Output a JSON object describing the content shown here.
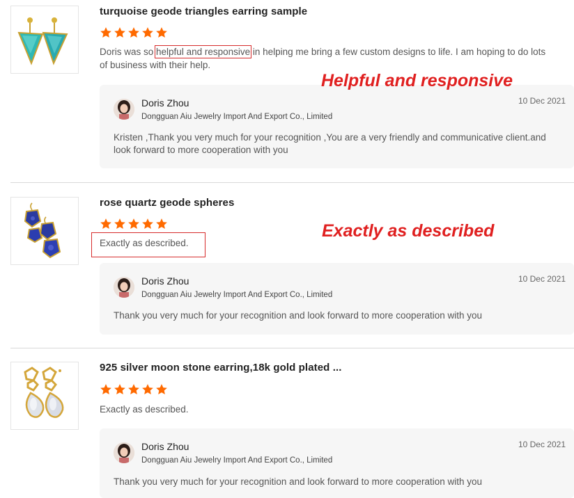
{
  "colors": {
    "star": "#ff6a00",
    "callout": "#e02020",
    "reply_bg": "#f6f6f6"
  },
  "reviews": [
    {
      "product_title": "turquoise geode triangles earring sample",
      "rating": 5,
      "comment_before": "Doris was so ",
      "comment_highlight": "helpful and responsive",
      "comment_after": " in helping me bring a few custom designs to life. I am hoping to do lots of business with their help.",
      "reply": {
        "name": "Doris Zhou",
        "company": "Dongguan Aiu Jewelry Import And Export Co., Limited",
        "date": "10 Dec 2021",
        "text": "Kristen ,Thank you very much for your recognition ,You are a very friendly and communicative client.and look forward to more cooperation with you"
      }
    },
    {
      "product_title": "rose quartz geode spheres",
      "rating": 5,
      "comment": "Exactly as described.",
      "reply": {
        "name": "Doris Zhou",
        "company": "Dongguan Aiu Jewelry Import And Export Co., Limited",
        "date": "10 Dec 2021",
        "text": "Thank you very much for your recognition and look forward to more cooperation with you"
      }
    },
    {
      "product_title": "925 silver moon stone earring,18k gold plated ...",
      "rating": 5,
      "comment": "Exactly as described.",
      "reply": {
        "name": "Doris Zhou",
        "company": "Dongguan Aiu Jewelry Import And Export Co., Limited",
        "date": "10 Dec 2021",
        "text": "Thank you very much for your recognition and look forward to more cooperation with you"
      }
    }
  ],
  "annotations": {
    "callout_1": "Helpful and responsive",
    "callout_2": "Exactly as described"
  }
}
